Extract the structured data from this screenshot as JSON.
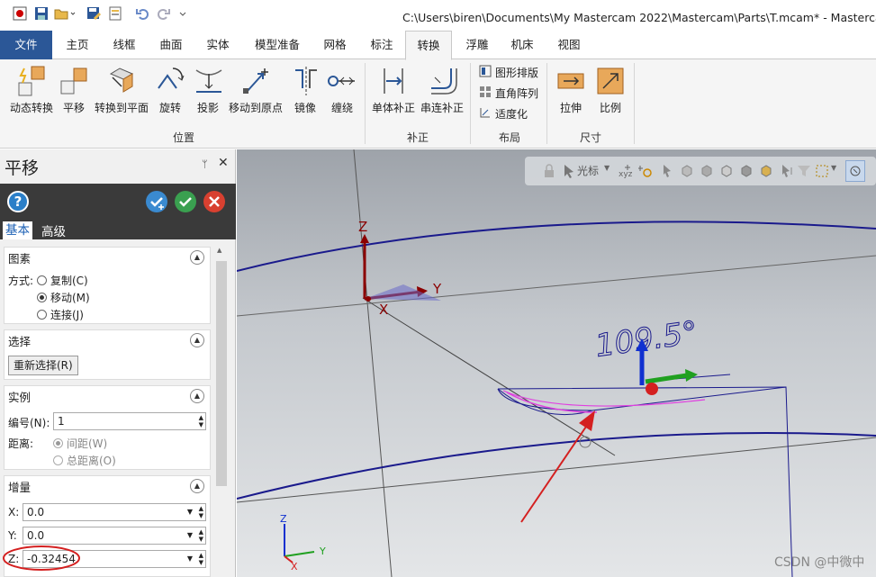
{
  "window": {
    "title": "C:\\Users\\biren\\Documents\\My Mastercam 2022\\Mastercam\\Parts\\T.mcam* - Mastercam 设"
  },
  "menu_tabs": [
    {
      "label": "文件"
    },
    {
      "label": "主页"
    },
    {
      "label": "线框"
    },
    {
      "label": "曲面"
    },
    {
      "label": "实体"
    },
    {
      "label": "模型准备"
    },
    {
      "label": "网格"
    },
    {
      "label": "标注"
    },
    {
      "label": "转换"
    },
    {
      "label": "浮雕"
    },
    {
      "label": "机床"
    },
    {
      "label": "视图"
    }
  ],
  "ribbon": {
    "position_group": {
      "label": "位置",
      "buttons": [
        "动态转换",
        "平移",
        "转换到平面",
        "旋转",
        "投影",
        "移动到原点",
        "镜像",
        "缠绕"
      ]
    },
    "compensation_group": {
      "label": "补正",
      "buttons": [
        "单体补正",
        "串连补正"
      ]
    },
    "layout_group": {
      "label": "布局",
      "buttons": [
        "图形排版",
        "直角阵列",
        "适度化"
      ]
    },
    "size_group": {
      "label": "尺寸",
      "buttons": [
        "拉伸",
        "比例"
      ]
    }
  },
  "panel": {
    "title": "平移",
    "pin_glyph": "ᛘ",
    "close_glyph": "✕",
    "help_glyph": "?",
    "subtabs": [
      "基本",
      "高级"
    ],
    "sections": {
      "entities": {
        "title": "图素",
        "method_label": "方式:",
        "options": [
          "复制(C)",
          "移动(M)",
          "连接(J)"
        ],
        "selected": "移动(M)"
      },
      "selection": {
        "title": "选择",
        "reselect_label": "重新选择(R)"
      },
      "instance": {
        "title": "实例",
        "number_label": "编号(N):",
        "number_value": "1",
        "distance_label": "距离:",
        "distance_options": [
          "间距(W)",
          "总距离(O)"
        ],
        "distance_selected": "间距(W)"
      },
      "delta": {
        "title": "增量",
        "x_label": "X:",
        "x_value": "0.0",
        "y_label": "Y:",
        "y_value": "0.0",
        "z_label": "Z:",
        "z_value": "-0.32454"
      }
    }
  },
  "viewport": {
    "toolbar": {
      "cursor_label": "光标"
    },
    "axes_main": {
      "x": "X",
      "y": "Y",
      "z": "Z"
    },
    "axes_small": {
      "x": "X",
      "y": "Y",
      "z": "Z"
    },
    "dimension_text": "109.5°",
    "watermark": "CSDN @中微中"
  },
  "colors": {
    "file_tab": "#2b5797",
    "geometry_line": "#1a1a8c",
    "highlight_curve": "#e040e0",
    "annotation_arrow": "#d42020",
    "annotation_circle": "#d42020",
    "axis_x": "#8b0000",
    "axis_y": "#8b0000",
    "axis_z": "#8b0000",
    "gnomon_x": "#d42020",
    "gnomon_y": "#20a020",
    "gnomon_z": "#1030d0"
  }
}
